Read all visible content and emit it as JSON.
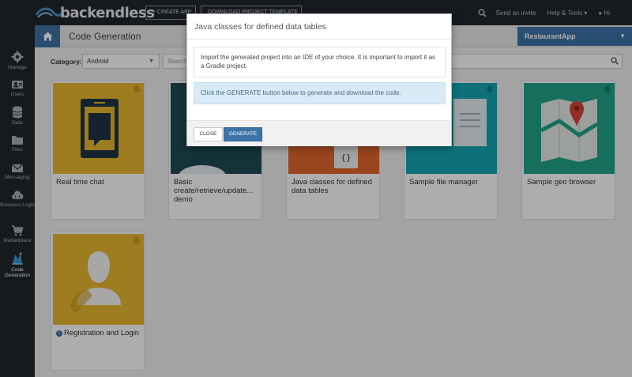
{
  "brand": {
    "name": "backendless"
  },
  "topbar": {
    "create_app_label": "+ CREATE APP",
    "download_template_label": "DOWNLOAD PROJECT TEMPLATE",
    "send_invite_label": "Send an invite",
    "help_tools_label": "Help & Tools ▾",
    "user_label": "Hi"
  },
  "leftnav": {
    "items": [
      {
        "label": "Manage",
        "icon": "gear-icon"
      },
      {
        "label": "Users",
        "icon": "users-icon"
      },
      {
        "label": "Data",
        "icon": "database-icon"
      },
      {
        "label": "Files",
        "icon": "folder-icon"
      },
      {
        "label": "Messaging",
        "icon": "envelope-icon"
      },
      {
        "label": "Business Logic",
        "icon": "cloud-code-icon"
      },
      {
        "label": "Marketplace",
        "icon": "cart-icon"
      },
      {
        "label": "Code Generation",
        "icon": "code-generation-icon"
      }
    ]
  },
  "header": {
    "title": "Code Generation",
    "app_selector": "RestaurantApp"
  },
  "filter": {
    "category_label": "Category:",
    "category_value": "Android",
    "search_placeholder": "Search"
  },
  "cards": [
    {
      "label": "Real time chat",
      "bg": "#e8b92e"
    },
    {
      "label": "Basic create/retrieve/update... demo",
      "bg": "#1f4a56"
    },
    {
      "label": "Java classes for defined data tables",
      "bg": "#e2662b"
    },
    {
      "label": "Sample file manager",
      "bg": "#16a5b4"
    },
    {
      "label": "Sample geo browser",
      "bg": "#21a389"
    },
    {
      "label": "Registration and Login",
      "bg": "#e8b92e"
    }
  ],
  "modal": {
    "title": "Java classes for defined data tables",
    "message": "Import the generated project into an IDE of your choice. It is important to import it as a Gradle project.",
    "info": "Click the GENERATE button below to generate and download the code.",
    "close_label": "CLOSE",
    "generate_label": "GENERATE"
  },
  "colors": {
    "accent": "#3e73a8",
    "sidebar": "#22272c"
  }
}
